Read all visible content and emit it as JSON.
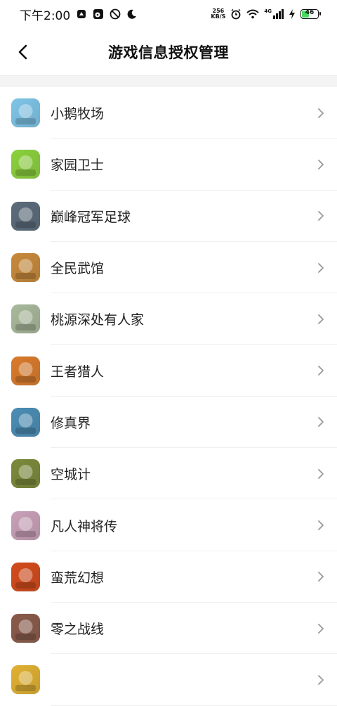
{
  "status_bar": {
    "time": "下午2:00",
    "net_speed_value": "256",
    "net_speed_unit": "KB/S",
    "network": "4G",
    "battery": "46",
    "battery_level": 0.46
  },
  "header": {
    "title": "游戏信息授权管理"
  },
  "games": [
    {
      "name": "小鹅牧场",
      "color": "#7ec4e8",
      "icon": "goose-ranch-icon"
    },
    {
      "name": "家园卫士",
      "color": "#8bd13c",
      "icon": "homeland-guard-icon"
    },
    {
      "name": "巅峰冠军足球",
      "color": "#5a6b7a",
      "icon": "football-icon"
    },
    {
      "name": "全民武馆",
      "color": "#c88a3a",
      "icon": "martial-hall-icon"
    },
    {
      "name": "桃源深处有人家",
      "color": "#a8b89a",
      "icon": "peach-garden-icon"
    },
    {
      "name": "王者猎人",
      "color": "#d97a2a",
      "icon": "king-hunter-icon"
    },
    {
      "name": "修真界",
      "color": "#4a8db5",
      "icon": "cultivation-icon"
    },
    {
      "name": "空城计",
      "color": "#7a8a3a",
      "icon": "empty-city-icon"
    },
    {
      "name": "凡人神将传",
      "color": "#c9a0b8",
      "icon": "mortal-general-icon"
    },
    {
      "name": "蛮荒幻想",
      "color": "#d44a1a",
      "icon": "wild-fantasy-icon"
    },
    {
      "name": "零之战线",
      "color": "#8a5a4a",
      "icon": "zero-frontline-icon"
    },
    {
      "name": "",
      "color": "#e0b030",
      "icon": "nba-game-icon"
    }
  ]
}
